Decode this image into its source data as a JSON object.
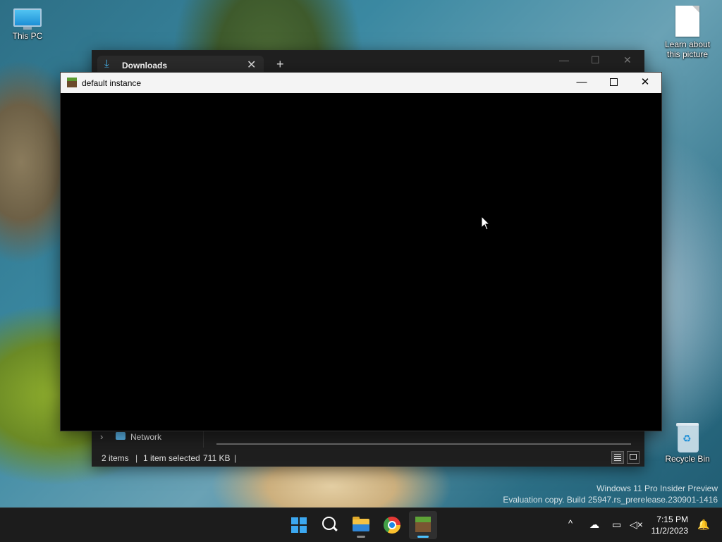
{
  "desktop": {
    "icons": [
      {
        "label": "This PC"
      },
      {
        "label": "Learn about this picture"
      },
      {
        "label": "Recycle Bin"
      }
    ],
    "watermark": {
      "line1": "Windows 11 Pro Insider Preview",
      "line2": "Evaluation copy. Build 25947.rs_prerelease.230901-1416"
    }
  },
  "explorer": {
    "tab_label": "Downloads",
    "tab_icon": "download-icon",
    "new_tab": "+",
    "nav_item": "Network",
    "status": {
      "items": "2 items",
      "selected": "1 item selected",
      "size": "711 KB"
    }
  },
  "instance_window": {
    "title": "default instance",
    "controls": {
      "minimize": "—",
      "close": "✕"
    }
  },
  "taskbar": {
    "apps": [
      {
        "name": "start",
        "icon": "windows-logo-icon"
      },
      {
        "name": "search",
        "icon": "search-icon"
      },
      {
        "name": "file-explorer",
        "icon": "folder-icon"
      },
      {
        "name": "chrome",
        "icon": "chrome-icon"
      },
      {
        "name": "minecraft",
        "icon": "minecraft-icon",
        "active": true
      }
    ],
    "tray": {
      "chevron": "^",
      "clock_time": "7:15 PM",
      "clock_date": "11/2/2023"
    }
  },
  "colors": {
    "accent": "#4cc2ff",
    "taskbar_bg": "#1c1c1c",
    "explorer_bg": "#1f1f1f",
    "titlebar_bg": "#f4f4f4"
  }
}
